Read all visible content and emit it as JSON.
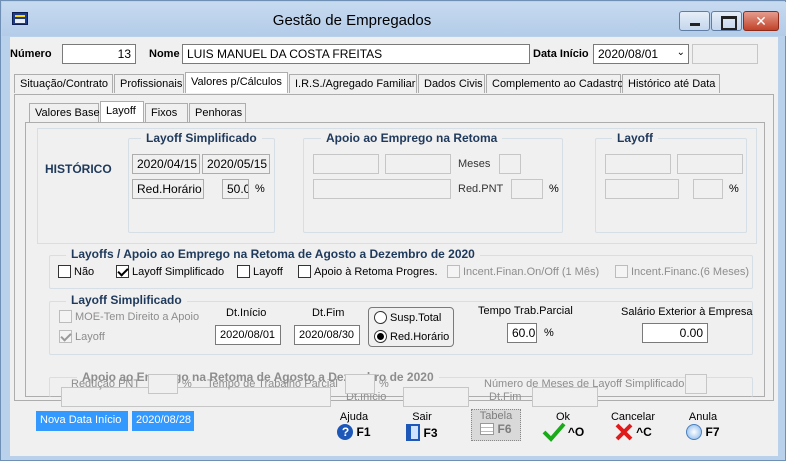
{
  "window": {
    "title": "Gestão de Empregados"
  },
  "header": {
    "numero_label": "Número",
    "numero_value": "13",
    "nome_label": "Nome",
    "nome_value": "LUIS MANUEL DA COSTA FREITAS",
    "data_inicio_label": "Data Início",
    "data_inicio_value": "2020/08/01"
  },
  "tabs": [
    "Situação/Contrato",
    "Profissionais",
    "Valores p/Cálculos",
    "I.R.S./Agregado Familiar",
    "Dados Civis",
    "Complemento ao Cadastro",
    "Histórico até Data"
  ],
  "subtabs": [
    "Valores Base",
    "Layoff",
    "Fixos",
    "Penhoras"
  ],
  "historico": {
    "label": "HISTÓRICO",
    "layoff_simplificado": {
      "title": "Layoff Simplificado",
      "date_from": "2020/04/15",
      "date_to": "2020/05/15",
      "type": "Red.Horário",
      "percent": "50.0",
      "pct_sign": "%"
    },
    "apoio": {
      "title": "Apoio ao Emprego na Retoma",
      "meses_label": "Meses",
      "red_pnt_label": "Red.PNT",
      "pct_sign": "%"
    },
    "layoff": {
      "title": "Layoff",
      "pct_sign": "%"
    }
  },
  "agosto_dezembro": {
    "title": "Layoffs / Apoio ao Emprego na Retoma de Agosto a Dezembro de 2020",
    "options": [
      {
        "label": "Não",
        "checked": false,
        "enabled": true
      },
      {
        "label": "Layoff Simplificado",
        "checked": true,
        "enabled": true
      },
      {
        "label": "Layoff",
        "checked": false,
        "enabled": true
      },
      {
        "label": "Apoio à Retoma Progres.",
        "checked": false,
        "enabled": true
      },
      {
        "label": "Incent.Finan.On/Off (1 Mês)",
        "checked": false,
        "enabled": false
      },
      {
        "label": "Incent.Financ.(6 Meses)",
        "checked": false,
        "enabled": false
      }
    ]
  },
  "layoff_simplificado": {
    "title": "Layoff Simplificado",
    "moe_label": "MOE-Tem Direito a Apoio",
    "layoff_label": "Layoff",
    "dt_inicio_label": "Dt.Início",
    "dt_inicio_value": "2020/08/01",
    "dt_fim_label": "Dt.Fim",
    "dt_fim_value": "2020/08/30",
    "susp_total_label": "Susp.Total",
    "red_horario_label": "Red.Horário",
    "tempo_label": "Tempo Trab.Parcial",
    "tempo_value": "60.0",
    "pct_sign": "%",
    "salario_label": "Salário Exterior à Empresa",
    "salario_value": "0.00"
  },
  "apoio_retoma": {
    "title": "Apoio ao Emprego na Retoma de Agosto a Dezembro de 2020",
    "dt_inicio_label": "Dt.Início",
    "dt_fim_label": "Dt.Fim",
    "reducao_label": "Redução PNT",
    "pct_sign": "%",
    "tempo_label": "Tempo de Trabalho Parcial",
    "meses_label": "Número de Meses de Layoff Simplificado"
  },
  "status": {
    "nova_data_label": "Nova Data Início",
    "nova_data_value": "2020/08/28"
  },
  "fkeys": [
    {
      "label": "Ajuda",
      "key": "F1",
      "icon": "help-icon"
    },
    {
      "label": "Sair",
      "key": "F3",
      "icon": "exit-icon"
    },
    {
      "label": "Tabela",
      "key": "F6",
      "icon": "table-icon"
    },
    {
      "label": "Ok",
      "key": "^O",
      "icon": "check-icon"
    },
    {
      "label": "Cancelar",
      "key": "^C",
      "icon": "cancel-x-icon"
    },
    {
      "label": "Anula",
      "key": "F7",
      "icon": "delete-icon"
    }
  ],
  "colors": {
    "status_bg": "#3399ff",
    "check_green": "#1aaa1a",
    "cancel_red": "#e01b1b",
    "help_blue": "#1d57b8"
  }
}
